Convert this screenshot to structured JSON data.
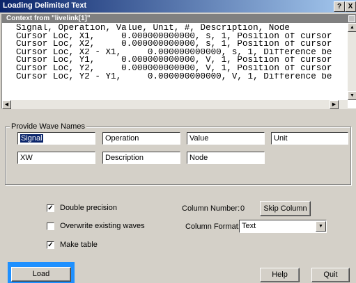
{
  "window": {
    "title": "Loading Delimited Text",
    "help_btn": "?",
    "close_btn": "X"
  },
  "context": {
    "title": "Context from \"livelink[1]\"",
    "lines": [
      "Signal, Operation, Value, Unit, #, Description, Node",
      "Cursor Loc, X1,     0.000000000000, s, 1, Position of cursor",
      "Cursor Loc, X2,     0.000000000000, s, 1, Position of cursor",
      "Cursor Loc, X2 - X1,     0.000000000000, s, 1, Difference be",
      "Cursor Loc, Y1,     0.000000000000, V, 1, Position of cursor",
      "Cursor Loc, Y2,     0.000000000000, V, 1, Position of cursor",
      "Cursor Loc, Y2 - Y1,     0.000000000000, V, 1, Difference be"
    ]
  },
  "wave_names": {
    "label": "Provide Wave Names",
    "row1": [
      "Signal",
      "Operation",
      "Value",
      "Unit"
    ],
    "row2": [
      "XW",
      "Description",
      "Node"
    ]
  },
  "options": {
    "double_precision": {
      "label": "Double precision",
      "checked": "✓"
    },
    "overwrite": {
      "label": "Overwrite existing waves",
      "checked": ""
    },
    "make_table": {
      "label": "Make table",
      "checked": "✓"
    }
  },
  "column": {
    "number_label": "Column Number:",
    "number_value": "0",
    "skip_label": "Skip Column",
    "format_label": "Column Format:",
    "format_value": "Text"
  },
  "buttons": {
    "load": "Load",
    "help": "Help",
    "quit": "Quit"
  }
}
